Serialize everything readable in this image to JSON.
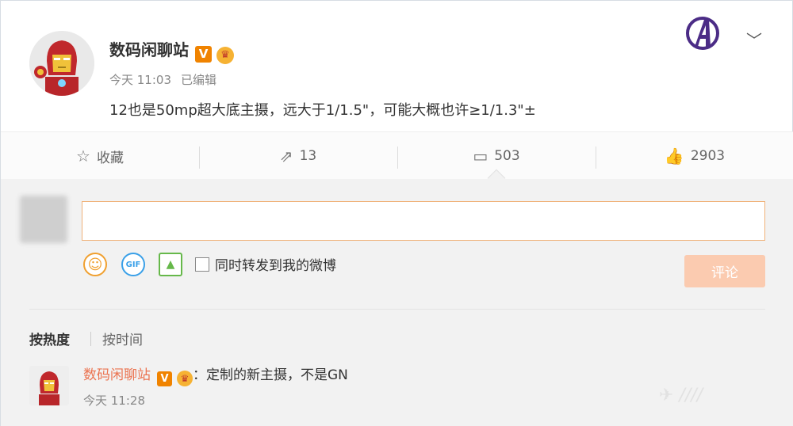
{
  "post": {
    "author": "数码闲聊站",
    "verified_badge": "V",
    "time": "今天 11:03",
    "edited": "已编辑",
    "text": "12也是50mp超大底主摄，远大于1/1.5\"，可能大概也许≥1/1.3\"±"
  },
  "actions": {
    "favorite": "收藏",
    "repost": "13",
    "comments": "503",
    "likes": "2903"
  },
  "composer": {
    "placeholder": "",
    "repost_checkbox_label": "同时转发到我的微博",
    "submit_label": "评论"
  },
  "sort": {
    "hot": "按热度",
    "time": "按时间"
  },
  "comment": {
    "author": "数码闲聊站",
    "verified_badge": "V",
    "text": "：定制的新主摄，不是GN",
    "time": "今天 11:28"
  },
  "colors": {
    "accent": "#eb7350",
    "verified": "#f08300",
    "submit_disabled": "#fbcbb0"
  }
}
